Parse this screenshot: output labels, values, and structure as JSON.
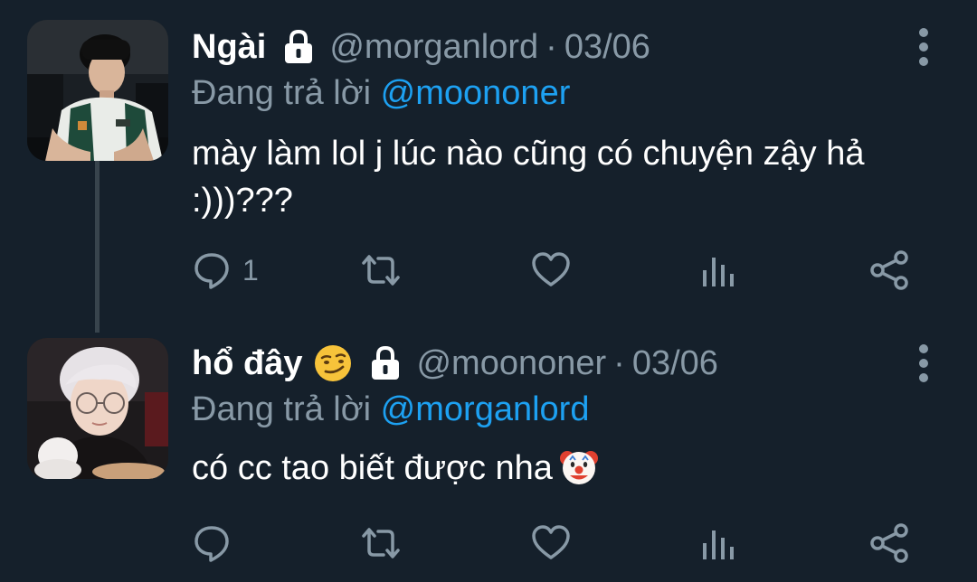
{
  "tweets": [
    {
      "display_name": "Ngài",
      "handle": "@morganlord",
      "separator": "·",
      "date": "03/06",
      "replying_prefix": "Đang trả lời",
      "replying_to": "@moononer",
      "text": "mày làm lol j lúc nào cũng có chuyện zậy hả :)))???",
      "reply_count": "1",
      "protected": true
    },
    {
      "display_name": "hổ đây",
      "handle": "@moononer",
      "separator": "·",
      "date": "03/06",
      "replying_prefix": "Đang trả lời",
      "replying_to": "@morganlord",
      "text": "có cc tao biết được nha",
      "reply_count": "",
      "protected": true
    }
  ],
  "icons": {
    "name_emoji": "smirking-face-emoji",
    "text_emoji": "clown-face-emoji",
    "lock": "lock-icon",
    "more": "more-vertical-icon",
    "actions": [
      "reply-icon",
      "retweet-icon",
      "like-icon",
      "analytics-icon",
      "share-icon"
    ]
  },
  "colors": {
    "background": "#15202b",
    "secondary_text": "#8899a6",
    "mention": "#1da1f2",
    "thread_line": "#38444d"
  }
}
